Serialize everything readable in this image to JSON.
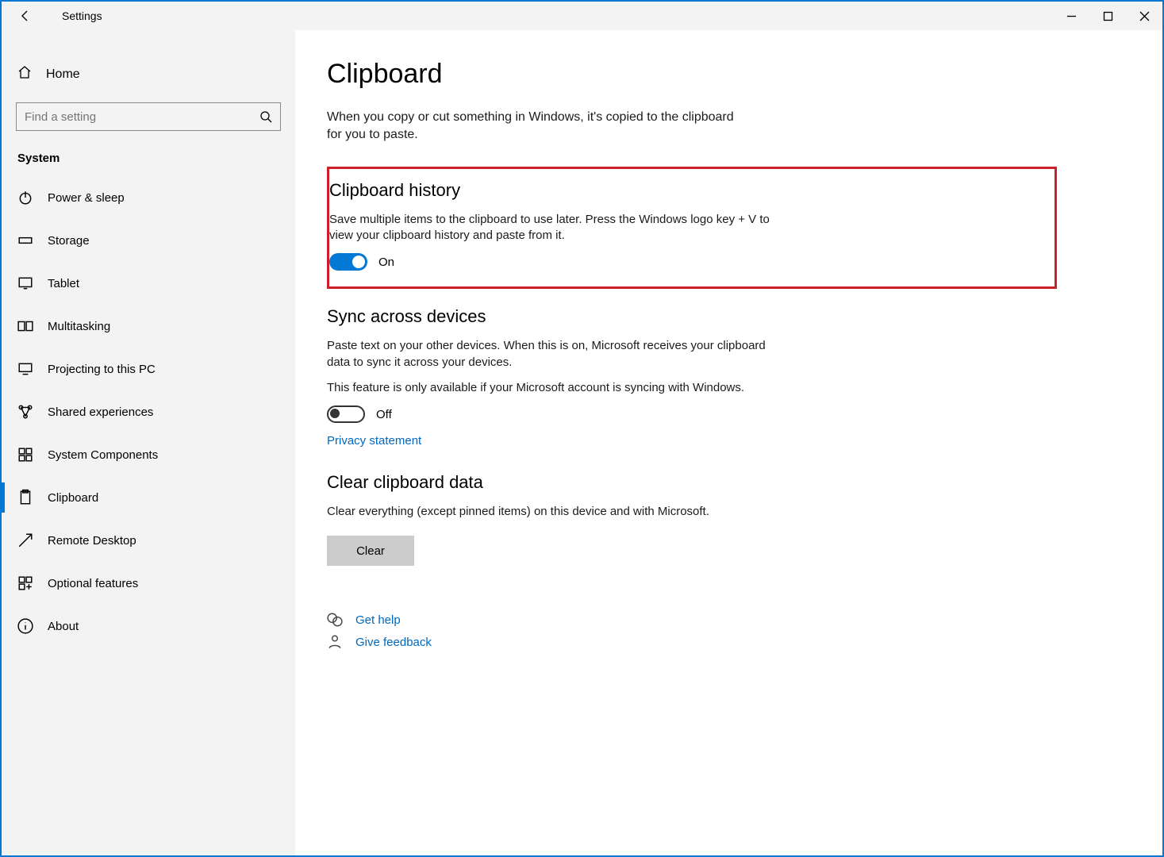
{
  "titlebar": {
    "title": "Settings"
  },
  "sidebar": {
    "home": "Home",
    "search_placeholder": "Find a setting",
    "section": "System",
    "items": [
      {
        "label": "Power & sleep"
      },
      {
        "label": "Storage"
      },
      {
        "label": "Tablet"
      },
      {
        "label": "Multitasking"
      },
      {
        "label": "Projecting to this PC"
      },
      {
        "label": "Shared experiences"
      },
      {
        "label": "System Components"
      },
      {
        "label": "Clipboard"
      },
      {
        "label": "Remote Desktop"
      },
      {
        "label": "Optional features"
      },
      {
        "label": "About"
      }
    ]
  },
  "main": {
    "title": "Clipboard",
    "intro": "When you copy or cut something in Windows, it's copied to the clipboard for you to paste.",
    "history": {
      "heading": "Clipboard history",
      "desc": "Save multiple items to the clipboard to use later. Press the Windows logo key + V to view your clipboard history and paste from it.",
      "state": "On"
    },
    "sync": {
      "heading": "Sync across devices",
      "desc1": "Paste text on your other devices. When this is on, Microsoft receives your clipboard data to sync it across your devices.",
      "desc2": "This feature is only available if your Microsoft account is syncing with Windows.",
      "state": "Off",
      "privacy": "Privacy statement"
    },
    "clear": {
      "heading": "Clear clipboard data",
      "desc": "Clear everything (except pinned items) on this device and with Microsoft.",
      "button": "Clear"
    },
    "help": "Get help",
    "feedback": "Give feedback"
  }
}
